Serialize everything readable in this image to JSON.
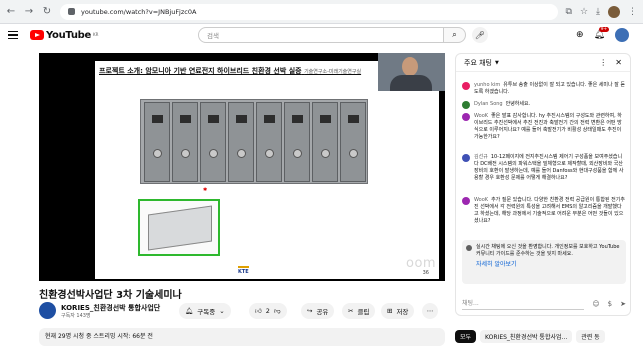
{
  "browser": {
    "url": "youtube.com/watch?v=JNBjuFjzc0A"
  },
  "header": {
    "logo_text": "YouTube",
    "region": "KR",
    "search_placeholder": "검색",
    "notification_count": "9+"
  },
  "video": {
    "slide_title": "프로젝트 소개: 암모니아 기반 연료전지 하이브리드 친환경 선박 실증",
    "slide_subtitle": "기술연구소-미래기술연구실",
    "slide_logo": "KTE",
    "slide_page": "36",
    "zoom_text": "oom",
    "title": "친환경선박사업단 3차 기술세미나"
  },
  "channel": {
    "name": "KORIES_친환경선박 통합사업단",
    "subscribers": "구독자 143명",
    "subscribe_label": "구독중",
    "like_count": "2",
    "share_label": "공유",
    "clip_label": "클립",
    "save_label": "저장"
  },
  "description": {
    "text": "현재 29명 시청 중 스트리밍 시작: 66분 전"
  },
  "chat": {
    "header": "주요 채팅",
    "messages": [
      {
        "author": "yunho kim",
        "text": "유투브 송출 이상없이 잘 되고 있습니다. 좋은 세미나 잘 듣도록 하겠습니다.",
        "color": "#e91e63",
        "initial": "Y"
      },
      {
        "author": "Dylan Song",
        "text": "안녕하세요.",
        "color": "#2e7d32",
        "initial": "D"
      },
      {
        "author": "WooK",
        "text": "좋은 발표 감사합니다. hy 추진시스템의 구성도와 관련하여, 하이브리드 추진선박에서 추진 전진과 축발전기 간의 전력 변환은 어떤 방식으로 이루어지나요? 예를 들어 축발전기가 비활성 상태일때도 추진이 가능한가요?",
        "color": "#9c27b0",
        "initial": "W"
      },
      {
        "author": "김선규",
        "text": "10-12페이지에 전지추진시스템 제어기 구성품을 보여주셨습니다 DC배전 시스템의 파워스택을 밀체형으로 제작할때, 외산장비와 국산장비의 호환이 발생하는데, 예를 들어 Danfoss와 현대구성품을 함께 사용할 경우 호환성 문제를 어떻게 해결하나요?",
        "color": "#3f51b5",
        "initial": "김"
      },
      {
        "author": "WooK",
        "text": "추가 질문 있습니다. 다양한 친환경 전력 공급원이 통합된 전기추진 선박에서 각 전력원의 특성을 고려해서 EMS의 알고리즘을 개발했다고 하셨는데, 해당 과정에서 기술적으로 어려운 부분은 어떤 것들이 있으셨나요?",
        "color": "#9c27b0",
        "initial": "W"
      }
    ],
    "info_text": "실시간 채팅에 오신 것을 환영합니다. 개인정보를 보호하고 YouTube 커뮤니티 가이드를 준수하는 것을 잊지 마세요.",
    "info_link": "자세히 알아보기",
    "input_placeholder": "채팅..."
  },
  "chips": [
    "모두",
    "KORIES_친환경선박 통합사업...",
    "관련 동"
  ]
}
